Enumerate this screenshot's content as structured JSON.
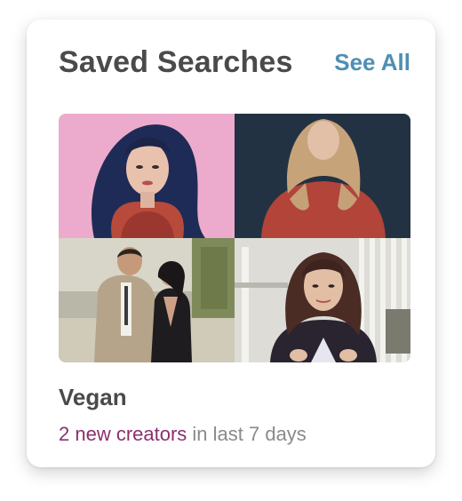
{
  "card": {
    "title": "Saved Searches",
    "see_all_label": "See All"
  },
  "saved_search": {
    "name": "Vegan",
    "new_creators": "2 new creators",
    "period_text": " in last 7 days"
  },
  "thumbnails": [
    {
      "icon": "creator-photo-1"
    },
    {
      "icon": "creator-photo-2"
    },
    {
      "icon": "creator-photo-3"
    },
    {
      "icon": "creator-photo-4"
    }
  ],
  "colors": {
    "title": "#4a4a4a",
    "link": "#4f8fb3",
    "highlight": "#8c2f6e",
    "muted": "#8a8a8a"
  }
}
